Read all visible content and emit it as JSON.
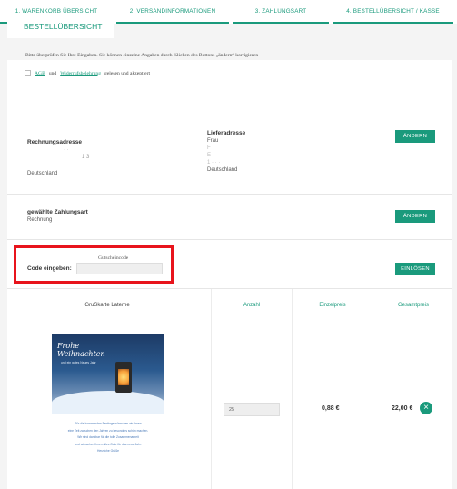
{
  "steps": [
    {
      "label": "1. WARENKORB ÜBERSICHT"
    },
    {
      "label": "2. VERSANDINFORMATIONEN"
    },
    {
      "label": "3. ZAHLUNGSART"
    },
    {
      "label": "4. BESTELLÜBERSICHT / KASSE"
    }
  ],
  "active_step": 4,
  "tab_title": "BESTELLÜBERSICHT",
  "intro_text": "Bitte überprüfen Sie Ihre Eingaben. Sie können einzelne Angaben durch Klicken des Buttons „ändern“ korrigieren",
  "agb": {
    "agb_link": "AGB",
    "and": "und",
    "withdrawal_link": "Widerrufsbelehrung",
    "suffix": "gelesen und akzeptiert"
  },
  "billing": {
    "heading": "Rechnungsadresse",
    "line1": "· ·",
    "line2": "1 3",
    "country": "Deutschland"
  },
  "shipping": {
    "heading": "Lieferadresse",
    "salutation": "Frau",
    "line1": "F",
    "line2": "E",
    "line3": "1 · · ·",
    "country": "Deutschland"
  },
  "change_button": "ÄNDERN",
  "payment": {
    "heading": "gewählte Zahlungsart",
    "method": "Rechnung"
  },
  "voucher": {
    "header": "Gutscheincode",
    "label": "Code eingeben:",
    "value": "",
    "redeem_button": "EINLÖSEN"
  },
  "table": {
    "headers": [
      "Anzahl",
      "Einzelpreis",
      "Gesamtpreis"
    ],
    "product_name": "GruSkarte Laterne",
    "card_title_line1": "Frohe",
    "card_title_line2": "Weihnachten",
    "card_subtitle": "und ein gutes Neues Jahr",
    "card_text": [
      "Für die kommenden Festtage wünschen wir Ihnen",
      "eine Zeit zwischen den Jahren zu besonders schön machen.",
      "Wir sind dankbar für die tolle Zusammenarbeit",
      "und wünschen Ihnen alles Gute für das neue Jahr.",
      "Herzliche Grüße"
    ],
    "quantity": "25",
    "unit_price": "0,88 €",
    "total_price": "22,00 €"
  },
  "colors": {
    "accent": "#1a9a7c",
    "highlight_box": "#e8141c"
  }
}
